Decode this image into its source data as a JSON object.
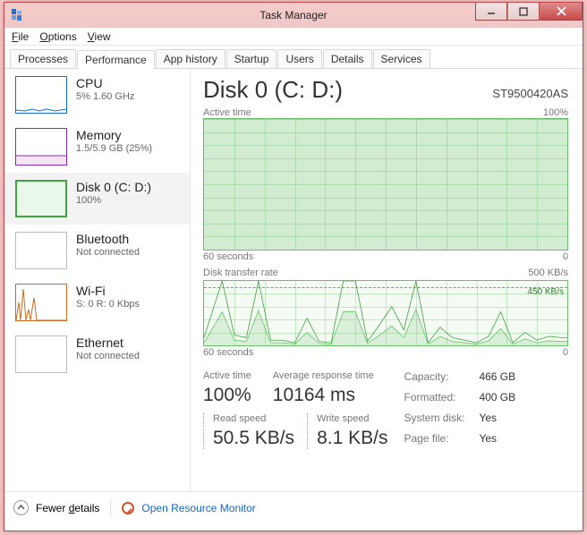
{
  "window": {
    "title": "Task Manager"
  },
  "menu": {
    "file": "File",
    "options": "Options",
    "view": "View"
  },
  "tabs": {
    "processes": "Processes",
    "performance": "Performance",
    "app_history": "App history",
    "startup": "Startup",
    "users": "Users",
    "details": "Details",
    "services": "Services"
  },
  "sidebar": {
    "cpu": {
      "title": "CPU",
      "sub": "5% 1.60 GHz"
    },
    "memory": {
      "title": "Memory",
      "sub": "1.5/5.9 GB (25%)"
    },
    "disk": {
      "title": "Disk 0 (C: D:)",
      "sub": "100%"
    },
    "bluetooth": {
      "title": "Bluetooth",
      "sub": "Not connected"
    },
    "wifi": {
      "title": "Wi-Fi",
      "sub": "S: 0 R: 0 Kbps"
    },
    "ethernet": {
      "title": "Ethernet",
      "sub": "Not connected"
    }
  },
  "main": {
    "title": "Disk 0 (C: D:)",
    "model": "ST9500420AS",
    "graph1": {
      "title": "Active time",
      "top_right": "100%",
      "bottom_left": "60 seconds",
      "bottom_right": "0"
    },
    "graph2": {
      "title": "Disk transfer rate",
      "top_right": "500 KB/s",
      "bottom_left": "60 seconds",
      "bottom_right": "0",
      "ref_label": "450 KB/s"
    },
    "stats_row1": {
      "active_time": {
        "label": "Active time",
        "value": "100%"
      },
      "avg_resp": {
        "label": "Average response time",
        "value": "10164 ms"
      }
    },
    "stats_row2": {
      "read": {
        "label": "Read speed",
        "value": "50.5 KB/s"
      },
      "write": {
        "label": "Write speed",
        "value": "8.1 KB/s"
      }
    },
    "props": {
      "capacity": {
        "k": "Capacity:",
        "v": "466 GB"
      },
      "formatted": {
        "k": "Formatted:",
        "v": "400 GB"
      },
      "sysdisk": {
        "k": "System disk:",
        "v": "Yes"
      },
      "pagefile": {
        "k": "Page file:",
        "v": "Yes"
      }
    }
  },
  "footer": {
    "fewer": "Fewer details",
    "monitor": "Open Resource Monitor"
  },
  "chart_data": [
    {
      "type": "area",
      "title": "Active time",
      "ylabel": "%",
      "xlabel": "seconds",
      "xlim": [
        60,
        0
      ],
      "ylim": [
        0,
        100
      ],
      "x": [
        60,
        55,
        50,
        45,
        40,
        35,
        30,
        25,
        20,
        15,
        10,
        5,
        0
      ],
      "series": [
        {
          "name": "Active time",
          "values": [
            100,
            100,
            100,
            100,
            100,
            100,
            100,
            100,
            100,
            100,
            100,
            100,
            100
          ]
        }
      ]
    },
    {
      "type": "line",
      "title": "Disk transfer rate",
      "ylabel": "KB/s",
      "xlabel": "seconds",
      "xlim": [
        60,
        0
      ],
      "ylim": [
        0,
        500
      ],
      "reference_line": 450,
      "x": [
        60,
        57,
        55,
        53,
        51,
        49,
        47,
        45,
        43,
        41,
        39,
        37,
        35,
        33,
        31,
        29,
        27,
        25,
        23,
        21,
        19,
        17,
        15,
        13,
        11,
        9,
        7,
        5,
        3,
        1,
        0
      ],
      "series": [
        {
          "name": "Read",
          "values": [
            60,
            500,
            80,
            60,
            500,
            40,
            40,
            20,
            210,
            30,
            20,
            500,
            500,
            30,
            160,
            300,
            120,
            500,
            20,
            140,
            60,
            40,
            20,
            70,
            260,
            20,
            100,
            40,
            70,
            60,
            60
          ]
        },
        {
          "name": "Write",
          "values": [
            20,
            260,
            40,
            30,
            270,
            20,
            20,
            10,
            100,
            15,
            10,
            260,
            260,
            15,
            80,
            150,
            60,
            280,
            10,
            70,
            30,
            20,
            10,
            35,
            130,
            10,
            50,
            20,
            35,
            30,
            30
          ]
        }
      ]
    }
  ]
}
